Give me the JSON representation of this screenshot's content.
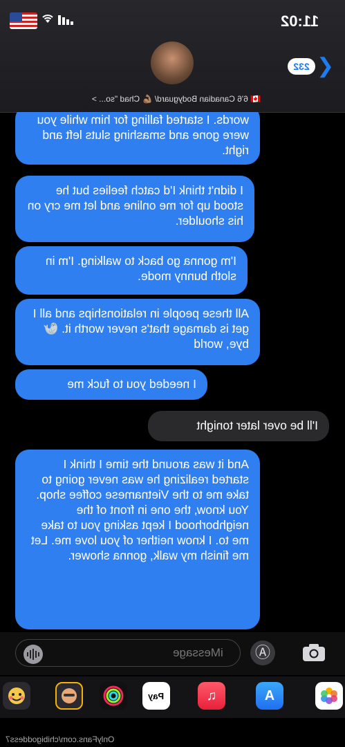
{
  "status": {
    "time": "11:02"
  },
  "header": {
    "contact": "🇨🇦 6'6 Canadian Bodyguard/ 💪🏽 Chad \"so... >",
    "back_count": "232"
  },
  "messages": [
    {
      "text": "words. I started falling for him while you were gone and smashing sluts left and right.",
      "type": "sent"
    },
    {
      "text": "I didn't think I'd catch feelies but he stood up for me online and let me cry on his shoulder.",
      "type": "sent"
    },
    {
      "text": "I'm gonna go back to walking. I'm in sloth bunny mode.",
      "type": "sent"
    },
    {
      "text": "All these people in relationships and all I get is damage that's never worth it. 🦭 bye, world",
      "type": "sent"
    },
    {
      "text": "I needed you to fuck me",
      "type": "sent"
    },
    {
      "text": "I'll be over later tonight",
      "type": "received"
    },
    {
      "text": "And it was around the time I think I started realizing he was never going to take me to the Vietnamese coffee shop. You know, the one in front of the neighborhood I kept asking you to take me to. I know neither of you love me. Let me finish my walk, gonna shower.",
      "type": "sent"
    }
  ],
  "composer": {
    "placeholder": "iMessage"
  },
  "dock": {
    "apps": [
      "photos-icon",
      "app-store-icon",
      "music-icon",
      "apple-pay-icon",
      "activity-icon",
      "memoji-icon",
      "animoji-icon"
    ],
    "pay_label": "Pay"
  },
  "watermark": "OnlyFans.com/chibigoddess7",
  "colors": {
    "bubble_sent": "#2f7ff0",
    "bubble_received": "#2a2a2d",
    "accent": "#1f7cf0"
  }
}
